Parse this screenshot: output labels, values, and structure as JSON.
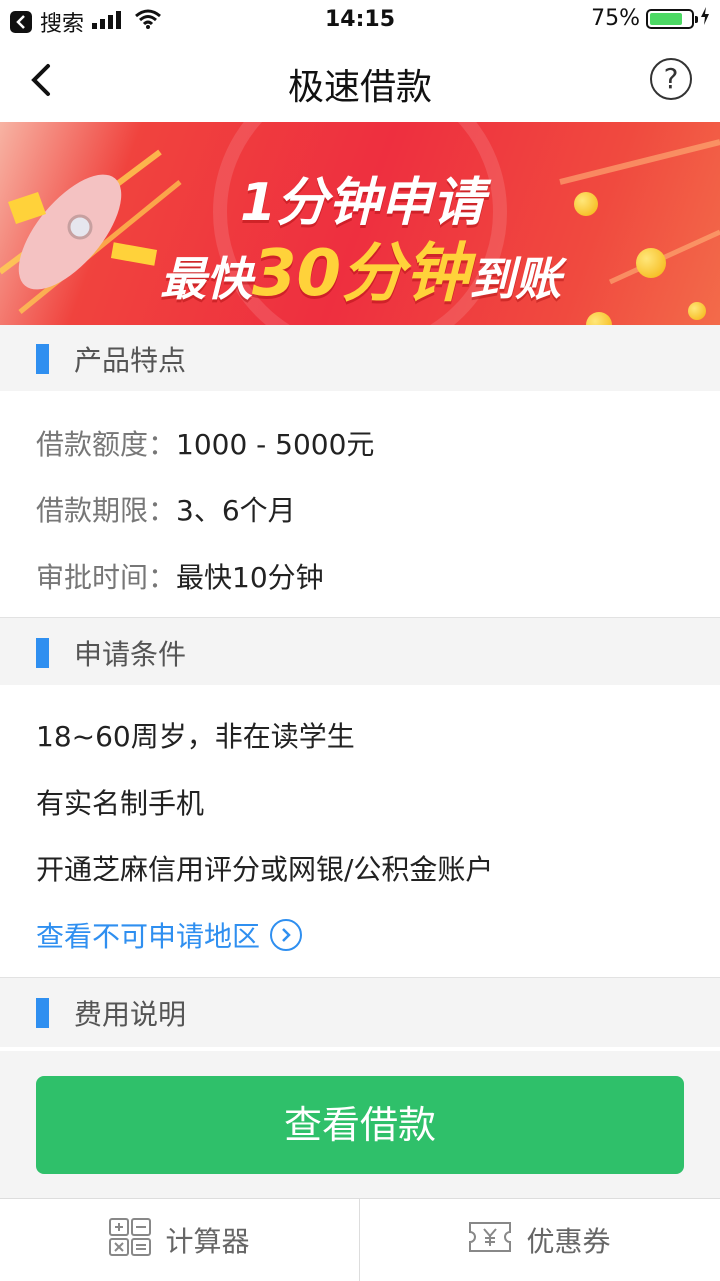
{
  "status": {
    "carrier": "搜索",
    "time": "14:15",
    "battery": "75%"
  },
  "nav": {
    "title": "极速借款",
    "help_icon": "question-icon"
  },
  "banner": {
    "line1": "1分钟申请",
    "line2_pre": "最快",
    "line2_hl": "30分钟",
    "line2_post": "到账"
  },
  "features": {
    "title": "产品特点",
    "rows": [
      {
        "label": "借款额度：",
        "value": "1000 - 5000元"
      },
      {
        "label": "借款期限：",
        "value": "3、6个月"
      },
      {
        "label": "审批时间：",
        "value": "最快10分钟"
      }
    ]
  },
  "conditions": {
    "title": "申请条件",
    "items": [
      "18~60周岁，非在读学生",
      "有实名制手机",
      "开通芝麻信用评分或网银/公积金账户"
    ],
    "link": "查看不可申请地区"
  },
  "fees": {
    "title": "费用说明"
  },
  "cta": {
    "label": "查看借款"
  },
  "tabs": [
    {
      "label": "计算器",
      "icon": "calculator-icon"
    },
    {
      "label": "优惠券",
      "icon": "coupon-icon"
    }
  ],
  "colors": {
    "accent": "#2f8ff0",
    "cta": "#2fc06a",
    "banner": "#ee2f3f"
  }
}
